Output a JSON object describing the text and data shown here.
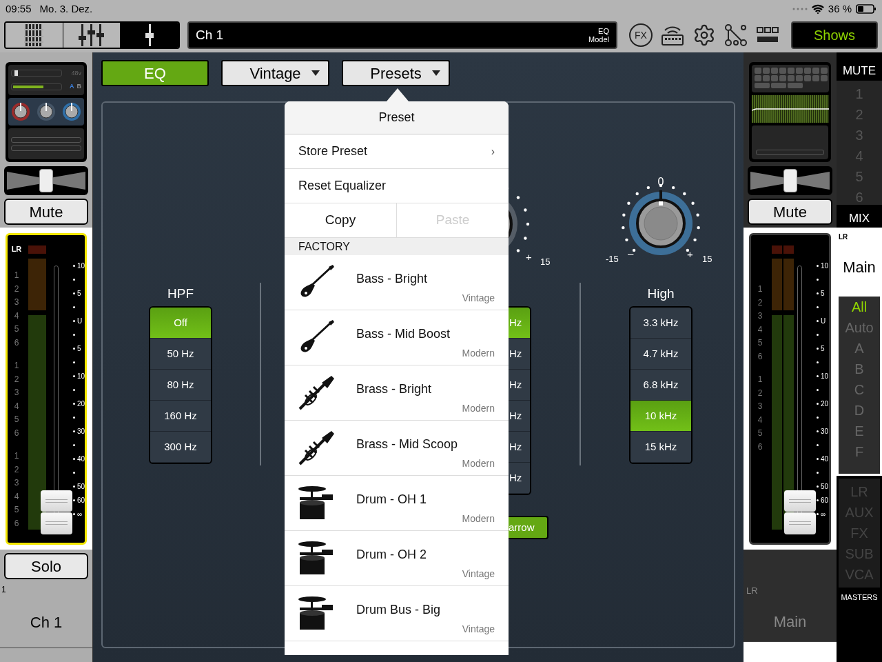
{
  "status_bar": {
    "time": "09:55",
    "date": "Mo. 3. Dez.",
    "battery": "36 %"
  },
  "toolbar": {
    "views": [
      {
        "kind": "multi",
        "selected": false
      },
      {
        "kind": "group",
        "selected": false
      },
      {
        "kind": "single",
        "selected": true
      }
    ],
    "channel_display": {
      "name": "Ch 1",
      "mode": "EQ",
      "model": "Model"
    },
    "fx_label": "FX",
    "shows_button": "Shows"
  },
  "left_strip": {
    "kind": "channel",
    "phantom_label": "48v",
    "gain": {
      "level": 0.05
    },
    "trim": {
      "level": 0.65
    },
    "ab": [
      {
        "label": "A",
        "selected": true
      },
      {
        "label": "B",
        "selected": false
      }
    ],
    "pan": {
      "level": 0.5
    },
    "mute": {
      "label": "Mute",
      "on": false
    },
    "fader": {
      "selected": true,
      "lr_label": "LR",
      "groups": [
        [
          "1",
          "2",
          "3",
          "4",
          "5",
          "6"
        ],
        [
          "1",
          "2",
          "3",
          "4",
          "5",
          "6"
        ],
        [
          "1",
          "2",
          "3",
          "4",
          "5",
          "6"
        ]
      ],
      "scale": [
        "10",
        "5",
        "U",
        "5",
        "10",
        "20",
        "30",
        "40",
        "50",
        "60",
        "∞"
      ],
      "level": 0.03
    },
    "solo": {
      "label": "Solo",
      "on": false
    },
    "number": "1",
    "name": "Ch 1"
  },
  "center": {
    "buttons": [
      {
        "kind": "toggle",
        "label": "EQ",
        "on": true
      },
      {
        "kind": "dropdown",
        "label": "Vintage"
      },
      {
        "kind": "dropdown",
        "label": "Presets"
      }
    ],
    "bands": [
      {
        "kind": "selector",
        "title": "HPF",
        "options": [
          {
            "label": "Off",
            "selected": true
          },
          {
            "label": "50 Hz",
            "selected": false
          },
          {
            "label": "80 Hz",
            "selected": false
          },
          {
            "label": "160 Hz",
            "selected": false
          },
          {
            "label": "300 Hz",
            "selected": false
          }
        ]
      },
      {
        "kind": "partial",
        "knob": {
          "plus": "+",
          "max": "15"
        },
        "options": [
          {
            "label": "Hz",
            "selected": true
          },
          {
            "label": "Hz",
            "selected": false
          },
          {
            "label": "Hz",
            "selected": false
          },
          {
            "label": "Hz",
            "selected": false
          },
          {
            "label": "Hz",
            "selected": false
          },
          {
            "label": "Hz",
            "selected": false
          }
        ],
        "width_button": {
          "label": "arrow",
          "on": true
        }
      },
      {
        "kind": "knob",
        "title": "High",
        "knob": {
          "center": "0",
          "min": "-15",
          "minus": "–",
          "plus": "+",
          "max": "15"
        },
        "options": [
          {
            "label": "3.3 kHz",
            "selected": false
          },
          {
            "label": "4.7 kHz",
            "selected": false
          },
          {
            "label": "6.8 kHz",
            "selected": false
          },
          {
            "label": "10 kHz",
            "selected": true
          },
          {
            "label": "15 kHz",
            "selected": false
          }
        ]
      }
    ]
  },
  "popover": {
    "title": "Preset",
    "actions": [
      {
        "label": "Store Preset",
        "chevron": "›"
      },
      {
        "label": "Reset Equalizer"
      }
    ],
    "copy": {
      "label": "Copy",
      "disabled": false
    },
    "paste": {
      "label": "Paste",
      "disabled": true
    },
    "section": "FACTORY",
    "presets": [
      {
        "kind": "guitar",
        "name": "Bass - Bright",
        "type": "Vintage"
      },
      {
        "kind": "guitar",
        "name": "Bass - Mid Boost",
        "type": "Modern"
      },
      {
        "kind": "trumpet",
        "name": "Brass - Bright",
        "type": "Modern"
      },
      {
        "kind": "trumpet",
        "name": "Brass - Mid Scoop",
        "type": "Modern"
      },
      {
        "kind": "drum",
        "name": "Drum - OH 1",
        "type": "Modern"
      },
      {
        "kind": "drum",
        "name": "Drum - OH 2",
        "type": "Vintage"
      },
      {
        "kind": "drum",
        "name": "Drum Bus - Big",
        "type": "Vintage"
      }
    ]
  },
  "right_strip": {
    "kind": "master",
    "pan": {
      "level": 0.5
    },
    "mute": {
      "label": "Mute",
      "on": false
    },
    "fader": {
      "selected": false,
      "groups": [
        [
          "1",
          "2",
          "3",
          "4",
          "5",
          "6"
        ],
        [
          "1",
          "2",
          "3",
          "4",
          "5",
          "6"
        ]
      ],
      "scale": [
        "10",
        "5",
        "U",
        "5",
        "10",
        "20",
        "30",
        "40",
        "50",
        "60",
        "∞"
      ],
      "level": 0.03
    },
    "bus": "LR",
    "name": "Main"
  },
  "side": {
    "mute_title": "MUTE",
    "mute_groups": [
      "1",
      "2",
      "3",
      "4",
      "5",
      "6"
    ],
    "mix_title": "MIX",
    "bus": "LR",
    "name": "Main",
    "filters": [
      {
        "label": "All",
        "selected": true
      },
      {
        "label": "Auto",
        "selected": false
      },
      {
        "label": "A",
        "selected": false
      },
      {
        "label": "B",
        "selected": false
      },
      {
        "label": "C",
        "selected": false
      },
      {
        "label": "D",
        "selected": false
      },
      {
        "label": "E",
        "selected": false
      },
      {
        "label": "F",
        "selected": false
      }
    ],
    "types": [
      "LR",
      "AUX",
      "FX",
      "SUB",
      "VCA"
    ],
    "footer": "MASTERS"
  }
}
